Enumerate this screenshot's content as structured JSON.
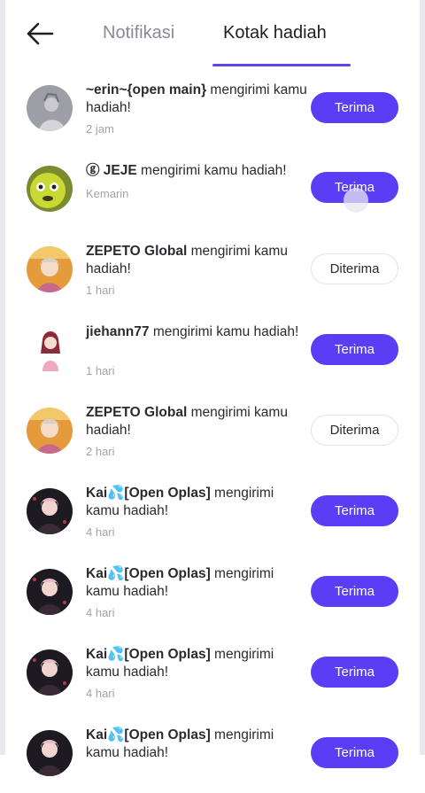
{
  "header": {
    "tabs": [
      {
        "label": "Notifikasi",
        "active": false
      },
      {
        "label": "Kotak hadiah",
        "active": true
      }
    ]
  },
  "colors": {
    "accent": "#5b3df6",
    "tab_underline": "#5b46f0"
  },
  "gifts": [
    {
      "sender": "~erin~{open main}",
      "message": "mengirimi kamu hadiah!",
      "time": "2 jam",
      "button": "Terima",
      "status": "pending"
    },
    {
      "sender": "ⓖ JEJE",
      "message": "mengirimi kamu hadiah!",
      "time": "Kemarin",
      "button": "Terima",
      "status": "pending"
    },
    {
      "sender": "ZEPETO Global",
      "message": "mengirimi kamu hadiah!",
      "time": "1 hari",
      "button": "Diterima",
      "status": "accepted"
    },
    {
      "sender": "jiehann77",
      "message": "mengirimi kamu hadiah!",
      "time": "1 hari",
      "button": "Terima",
      "status": "pending"
    },
    {
      "sender": "ZEPETO Global",
      "message": "mengirimi kamu hadiah!",
      "time": "2 hari",
      "button": "Diterima",
      "status": "accepted"
    },
    {
      "sender": "Kai💦[Open Oplas]",
      "message": "mengirimi kamu hadiah!",
      "time": "4 hari",
      "button": "Terima",
      "status": "pending"
    },
    {
      "sender": "Kai💦[Open Oplas]",
      "message": "mengirimi kamu hadiah!",
      "time": "4 hari",
      "button": "Terima",
      "status": "pending"
    },
    {
      "sender": "Kai💦[Open Oplas]",
      "message": "mengirimi kamu hadiah!",
      "time": "4 hari",
      "button": "Terima",
      "status": "pending"
    },
    {
      "sender": "Kai💦[Open Oplas]",
      "message": "mengirimi kamu hadiah!",
      "time": "",
      "button": "Terima",
      "status": "pending"
    }
  ]
}
